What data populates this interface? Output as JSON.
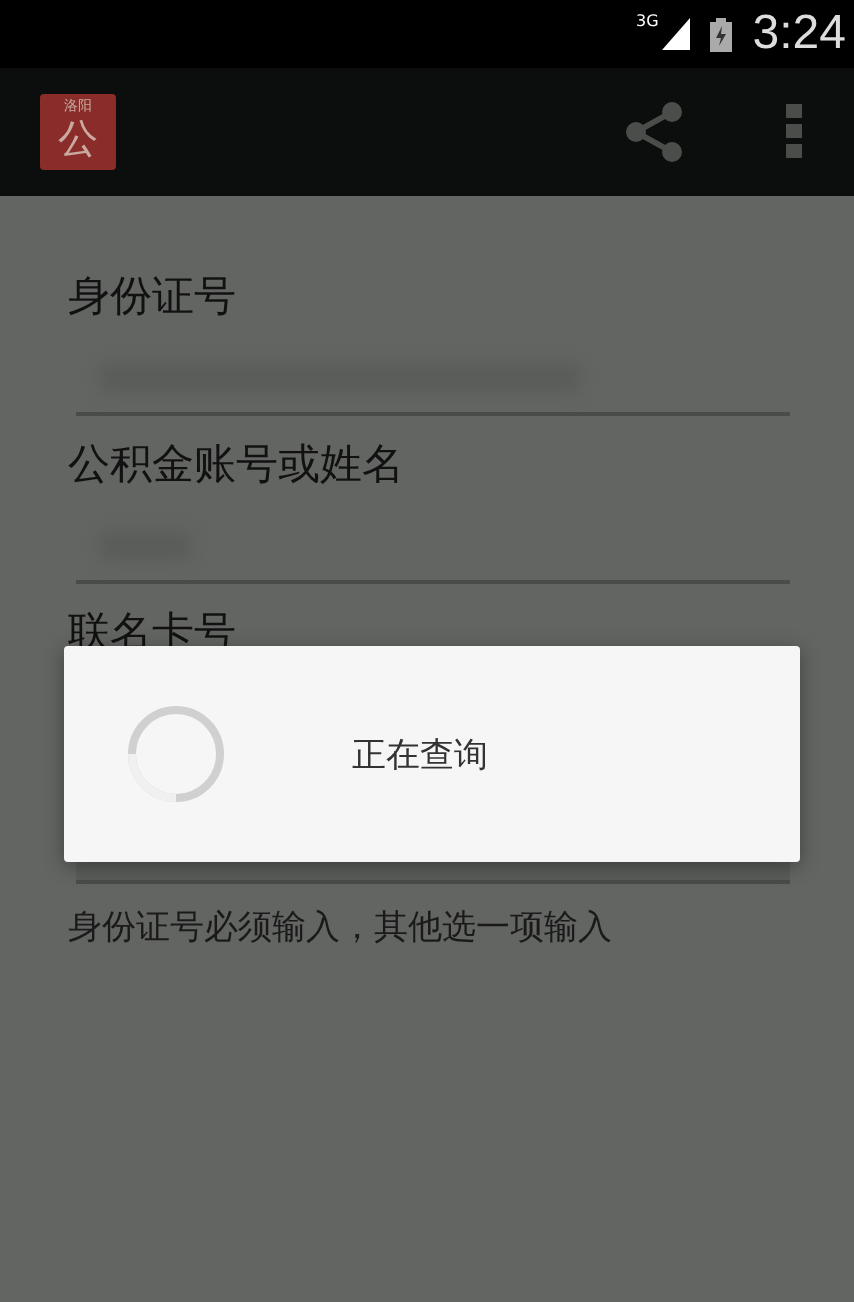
{
  "status_bar": {
    "network": "3G",
    "time": "3:24"
  },
  "app_bar": {
    "logo": {
      "top": "洛阳",
      "main": "公"
    }
  },
  "form": {
    "fields": [
      {
        "label": "身份证号"
      },
      {
        "label": "公积金账号或姓名"
      },
      {
        "label": "联名卡号"
      }
    ],
    "hint": "身份证号必须输入，其他选一项输入"
  },
  "dialog": {
    "message": "正在查询"
  }
}
